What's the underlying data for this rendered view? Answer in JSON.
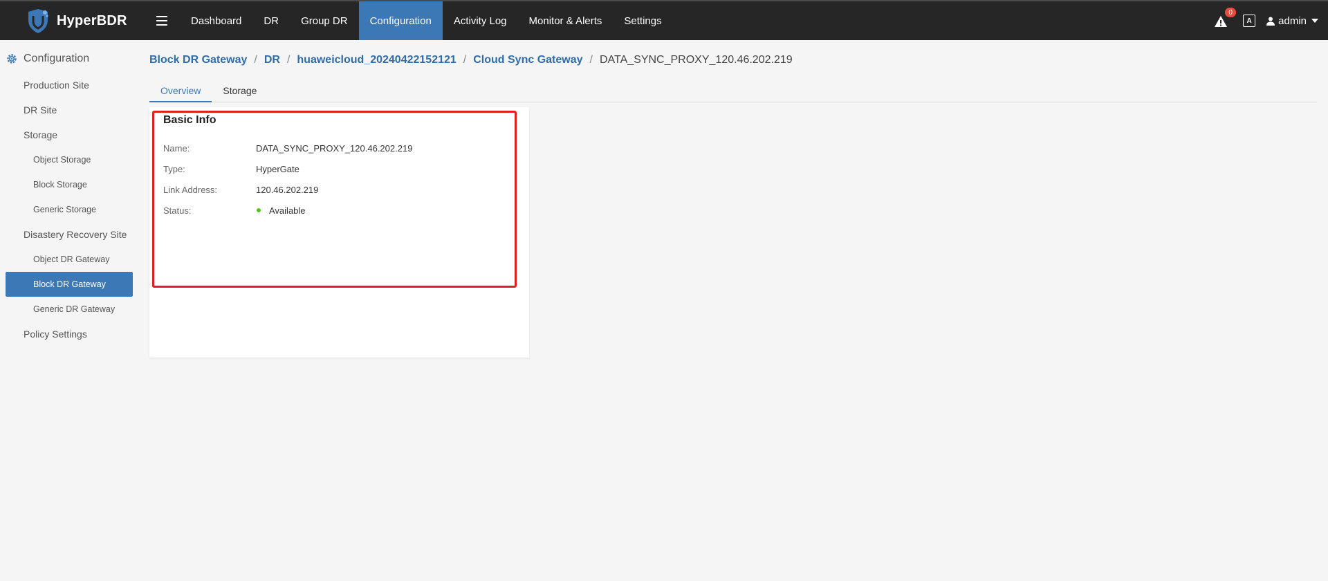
{
  "app": {
    "name": "HyperBDR"
  },
  "topbar": {
    "menu_icon": "hamburger-icon",
    "nav": [
      {
        "label": "Dashboard",
        "active": false
      },
      {
        "label": "DR",
        "active": false
      },
      {
        "label": "Group DR",
        "active": false
      },
      {
        "label": "Configuration",
        "active": true
      },
      {
        "label": "Activity Log",
        "active": false
      },
      {
        "label": "Monitor & Alerts",
        "active": false
      },
      {
        "label": "Settings",
        "active": false
      }
    ],
    "alert_count": "0",
    "lang_label": "A",
    "user": "admin"
  },
  "sidebar": {
    "title": "Configuration",
    "items": [
      {
        "label": "Production Site",
        "level": 1
      },
      {
        "label": "DR Site",
        "level": 1
      },
      {
        "label": "Storage",
        "level": 1
      },
      {
        "label": "Object Storage",
        "level": 2
      },
      {
        "label": "Block Storage",
        "level": 2
      },
      {
        "label": "Generic Storage",
        "level": 2
      },
      {
        "label": "Disastery Recovery Site",
        "level": 1
      },
      {
        "label": "Object DR Gateway",
        "level": 2
      },
      {
        "label": "Block DR Gateway",
        "level": 2,
        "active": true
      },
      {
        "label": "Generic DR Gateway",
        "level": 2
      },
      {
        "label": "Policy Settings",
        "level": 1
      }
    ]
  },
  "breadcrumb": {
    "links": [
      "Block DR Gateway",
      "DR",
      "huaweicloud_20240422152121",
      "Cloud Sync Gateway"
    ],
    "current": "DATA_SYNC_PROXY_120.46.202.219",
    "separator": "/"
  },
  "tabs": [
    {
      "label": "Overview",
      "active": true
    },
    {
      "label": "Storage",
      "active": false
    }
  ],
  "basic_info": {
    "title": "Basic Info",
    "rows": [
      {
        "label": "Name:",
        "value": "DATA_SYNC_PROXY_120.46.202.219"
      },
      {
        "label": "Type:",
        "value": "HyperGate"
      },
      {
        "label": "Link Address:",
        "value": "120.46.202.219"
      },
      {
        "label": "Status:",
        "value": "Available"
      }
    ]
  },
  "colors": {
    "topbar_bg": "#262626",
    "accent": "#3d78b6",
    "link": "#2f6ca8",
    "highlight_border": "#e02020",
    "status_available": "#52c41a",
    "badge": "#e74c3c"
  }
}
